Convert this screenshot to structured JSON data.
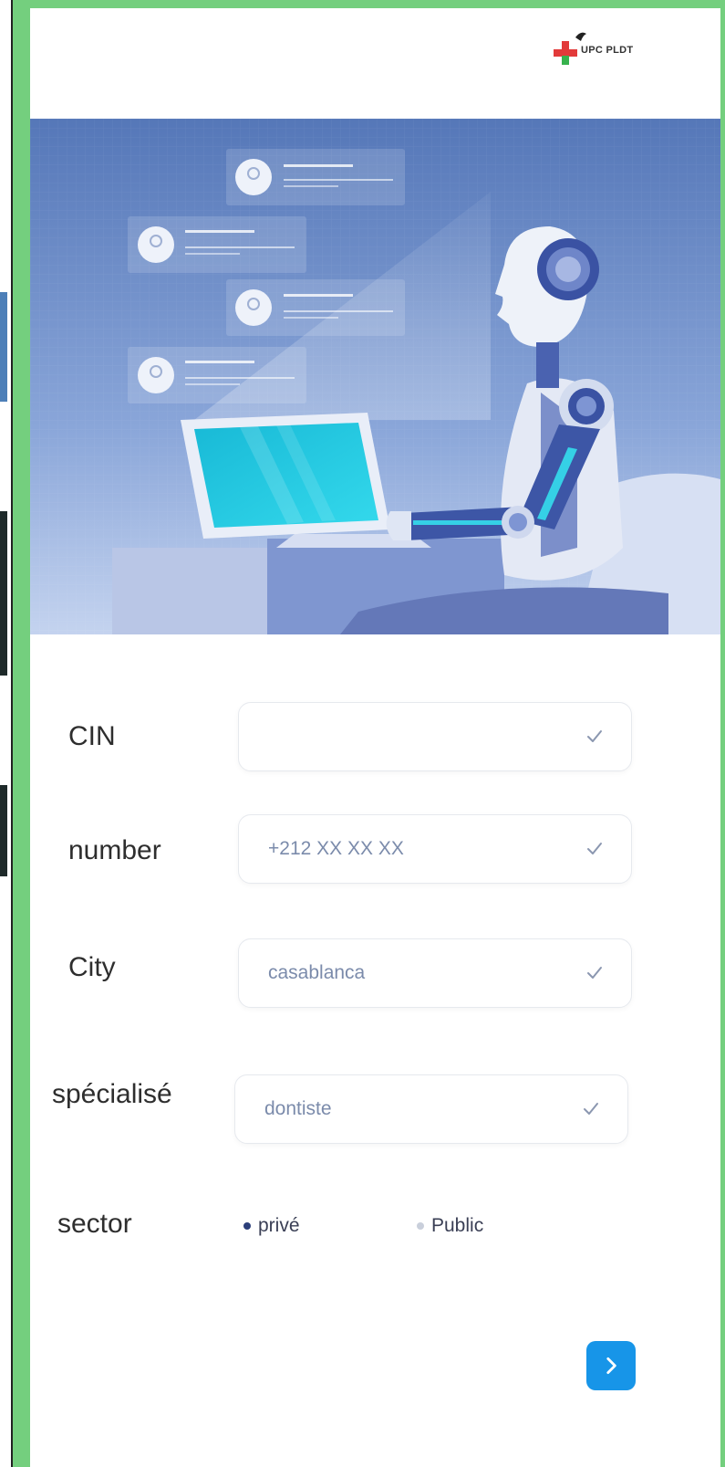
{
  "brand": {
    "logo_text": "UPC PLDT"
  },
  "form": {
    "fields": [
      {
        "label": "CIN",
        "value": "",
        "placeholder": ""
      },
      {
        "label": "number",
        "value": "",
        "placeholder": "+212 XX XX XX"
      },
      {
        "label": "City",
        "value": "",
        "placeholder": "casablanca"
      },
      {
        "label": "spécialisé",
        "value": "",
        "placeholder": "dontiste"
      }
    ],
    "sector": {
      "label": "sector",
      "options": [
        {
          "label": "privé",
          "selected": true
        },
        {
          "label": "Public",
          "selected": false
        }
      ]
    }
  },
  "colors": {
    "frame": "#74cf7e",
    "accent": "#1795e8",
    "hero_bg": "#6d8bc9",
    "input_text": "#6a7d9e"
  },
  "icons": {
    "field_check": "check-icon",
    "next": "chevron-right-icon"
  }
}
